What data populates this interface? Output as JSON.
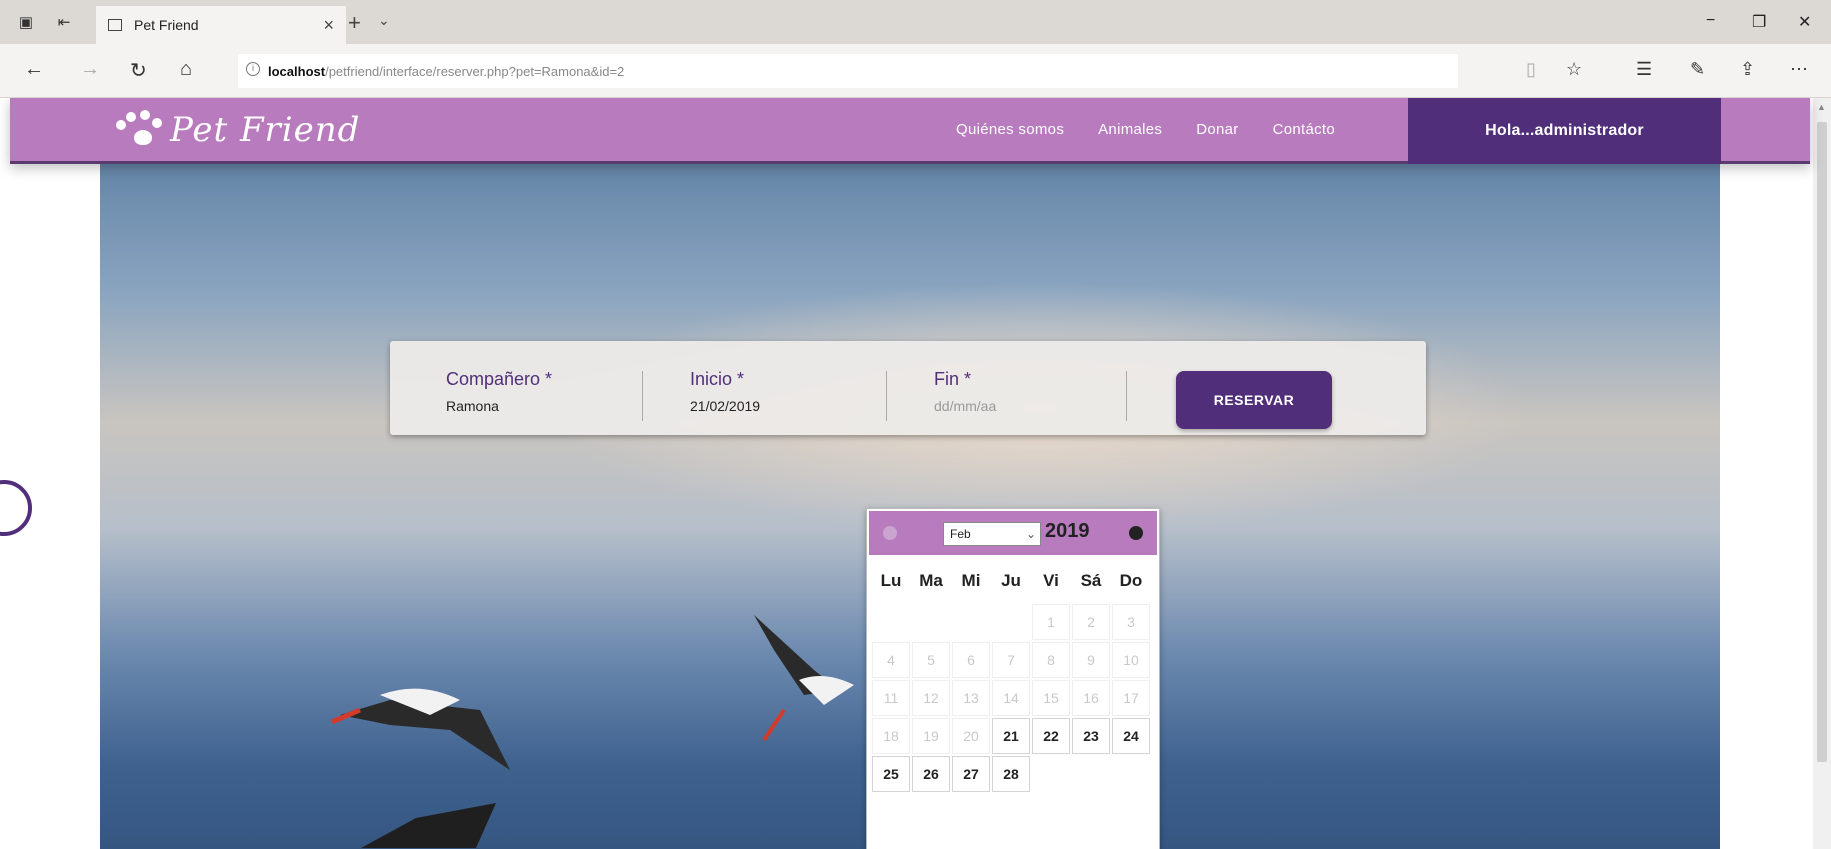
{
  "browser": {
    "tab_title": "Pet Friend",
    "url_host": "localhost",
    "url_path": "/petfriend/interface/reserver.php?pet=Ramona&id=2"
  },
  "site": {
    "brand": "Pet Friend",
    "menu": [
      "Quiénes somos",
      "Animales",
      "Donar",
      "Contácto"
    ],
    "user_greeting": "Hola...administrador",
    "accent_color": "#512e7a",
    "nav_color": "#b87bbe"
  },
  "booking": {
    "companion_label": "Compañero *",
    "companion_value": "Ramona",
    "start_label": "Inicio *",
    "start_value": "21/02/2019",
    "end_label": "Fin *",
    "end_placeholder": "dd/mm/aa",
    "submit_label": "RESERVAR"
  },
  "datepicker": {
    "month": "Feb",
    "year": "2019",
    "weekdays": [
      "Lu",
      "Ma",
      "Mi",
      "Ju",
      "Vi",
      "Sá",
      "Do"
    ],
    "days": [
      "1",
      "2",
      "3",
      "4",
      "5",
      "6",
      "7",
      "8",
      "9",
      "10",
      "11",
      "12",
      "13",
      "14",
      "15",
      "16",
      "17",
      "18",
      "19",
      "20",
      "21",
      "22",
      "23",
      "24",
      "25",
      "26",
      "27",
      "28"
    ],
    "first_active_day": 21
  }
}
